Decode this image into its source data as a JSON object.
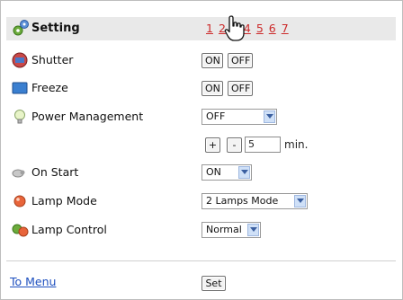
{
  "header": {
    "title": "Setting",
    "tabs": [
      "1",
      "2",
      "3",
      "4",
      "5",
      "6",
      "7"
    ],
    "active_tab": "3"
  },
  "rows": {
    "shutter": {
      "label": "Shutter",
      "on_label": "ON",
      "off_label": "OFF"
    },
    "freeze": {
      "label": "Freeze",
      "on_label": "ON",
      "off_label": "OFF"
    },
    "power_management": {
      "label": "Power Management",
      "value": "OFF",
      "plus_label": "+",
      "minus_label": "-",
      "minutes": "5",
      "unit": "min."
    },
    "on_start": {
      "label": "On Start",
      "value": "ON"
    },
    "lamp_mode": {
      "label": "Lamp Mode",
      "value": "2 Lamps Mode"
    },
    "lamp_control": {
      "label": "Lamp Control",
      "value": "Normal"
    }
  },
  "footer": {
    "menu_link": "To Menu",
    "set_label": "Set"
  },
  "colors": {
    "tab_link": "#cc2a2a",
    "link": "#1d4fbf",
    "header_bg": "#e9e9e9"
  }
}
